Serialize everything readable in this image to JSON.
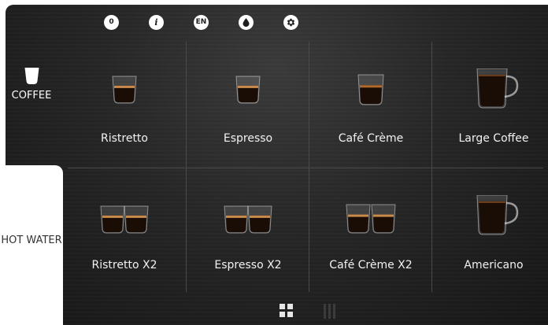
{
  "topbar": {
    "counter": "0",
    "info": "i",
    "language": "EN",
    "icons": [
      "counter-icon",
      "info-icon",
      "language-icon",
      "water-drop-icon",
      "gear-icon"
    ]
  },
  "sidebar": {
    "items": [
      {
        "label": "COFFEE",
        "active": true
      },
      {
        "label": "HOT WATER",
        "active": false
      }
    ]
  },
  "drinks": [
    {
      "name": "Ristretto",
      "glass": "small-single"
    },
    {
      "name": "Espresso",
      "glass": "small-single"
    },
    {
      "name": "Café Crème",
      "glass": "tall-single"
    },
    {
      "name": "Large Coffee",
      "glass": "mug"
    },
    {
      "name": "Ristretto X2",
      "glass": "small-double"
    },
    {
      "name": "Espresso X2",
      "glass": "small-double"
    },
    {
      "name": "Café Crème X2",
      "glass": "tall-double"
    },
    {
      "name": "Americano",
      "glass": "mug"
    }
  ],
  "view_toggle": {
    "icons": [
      "grid-view-icon",
      "list-view-icon"
    ],
    "active": "grid-view-icon"
  },
  "colors": {
    "panel": "#262626",
    "text": "#f2f2f2",
    "divider": "#4a4a4a",
    "coffee": "#1a0d05",
    "crema": "#c98a4b"
  }
}
